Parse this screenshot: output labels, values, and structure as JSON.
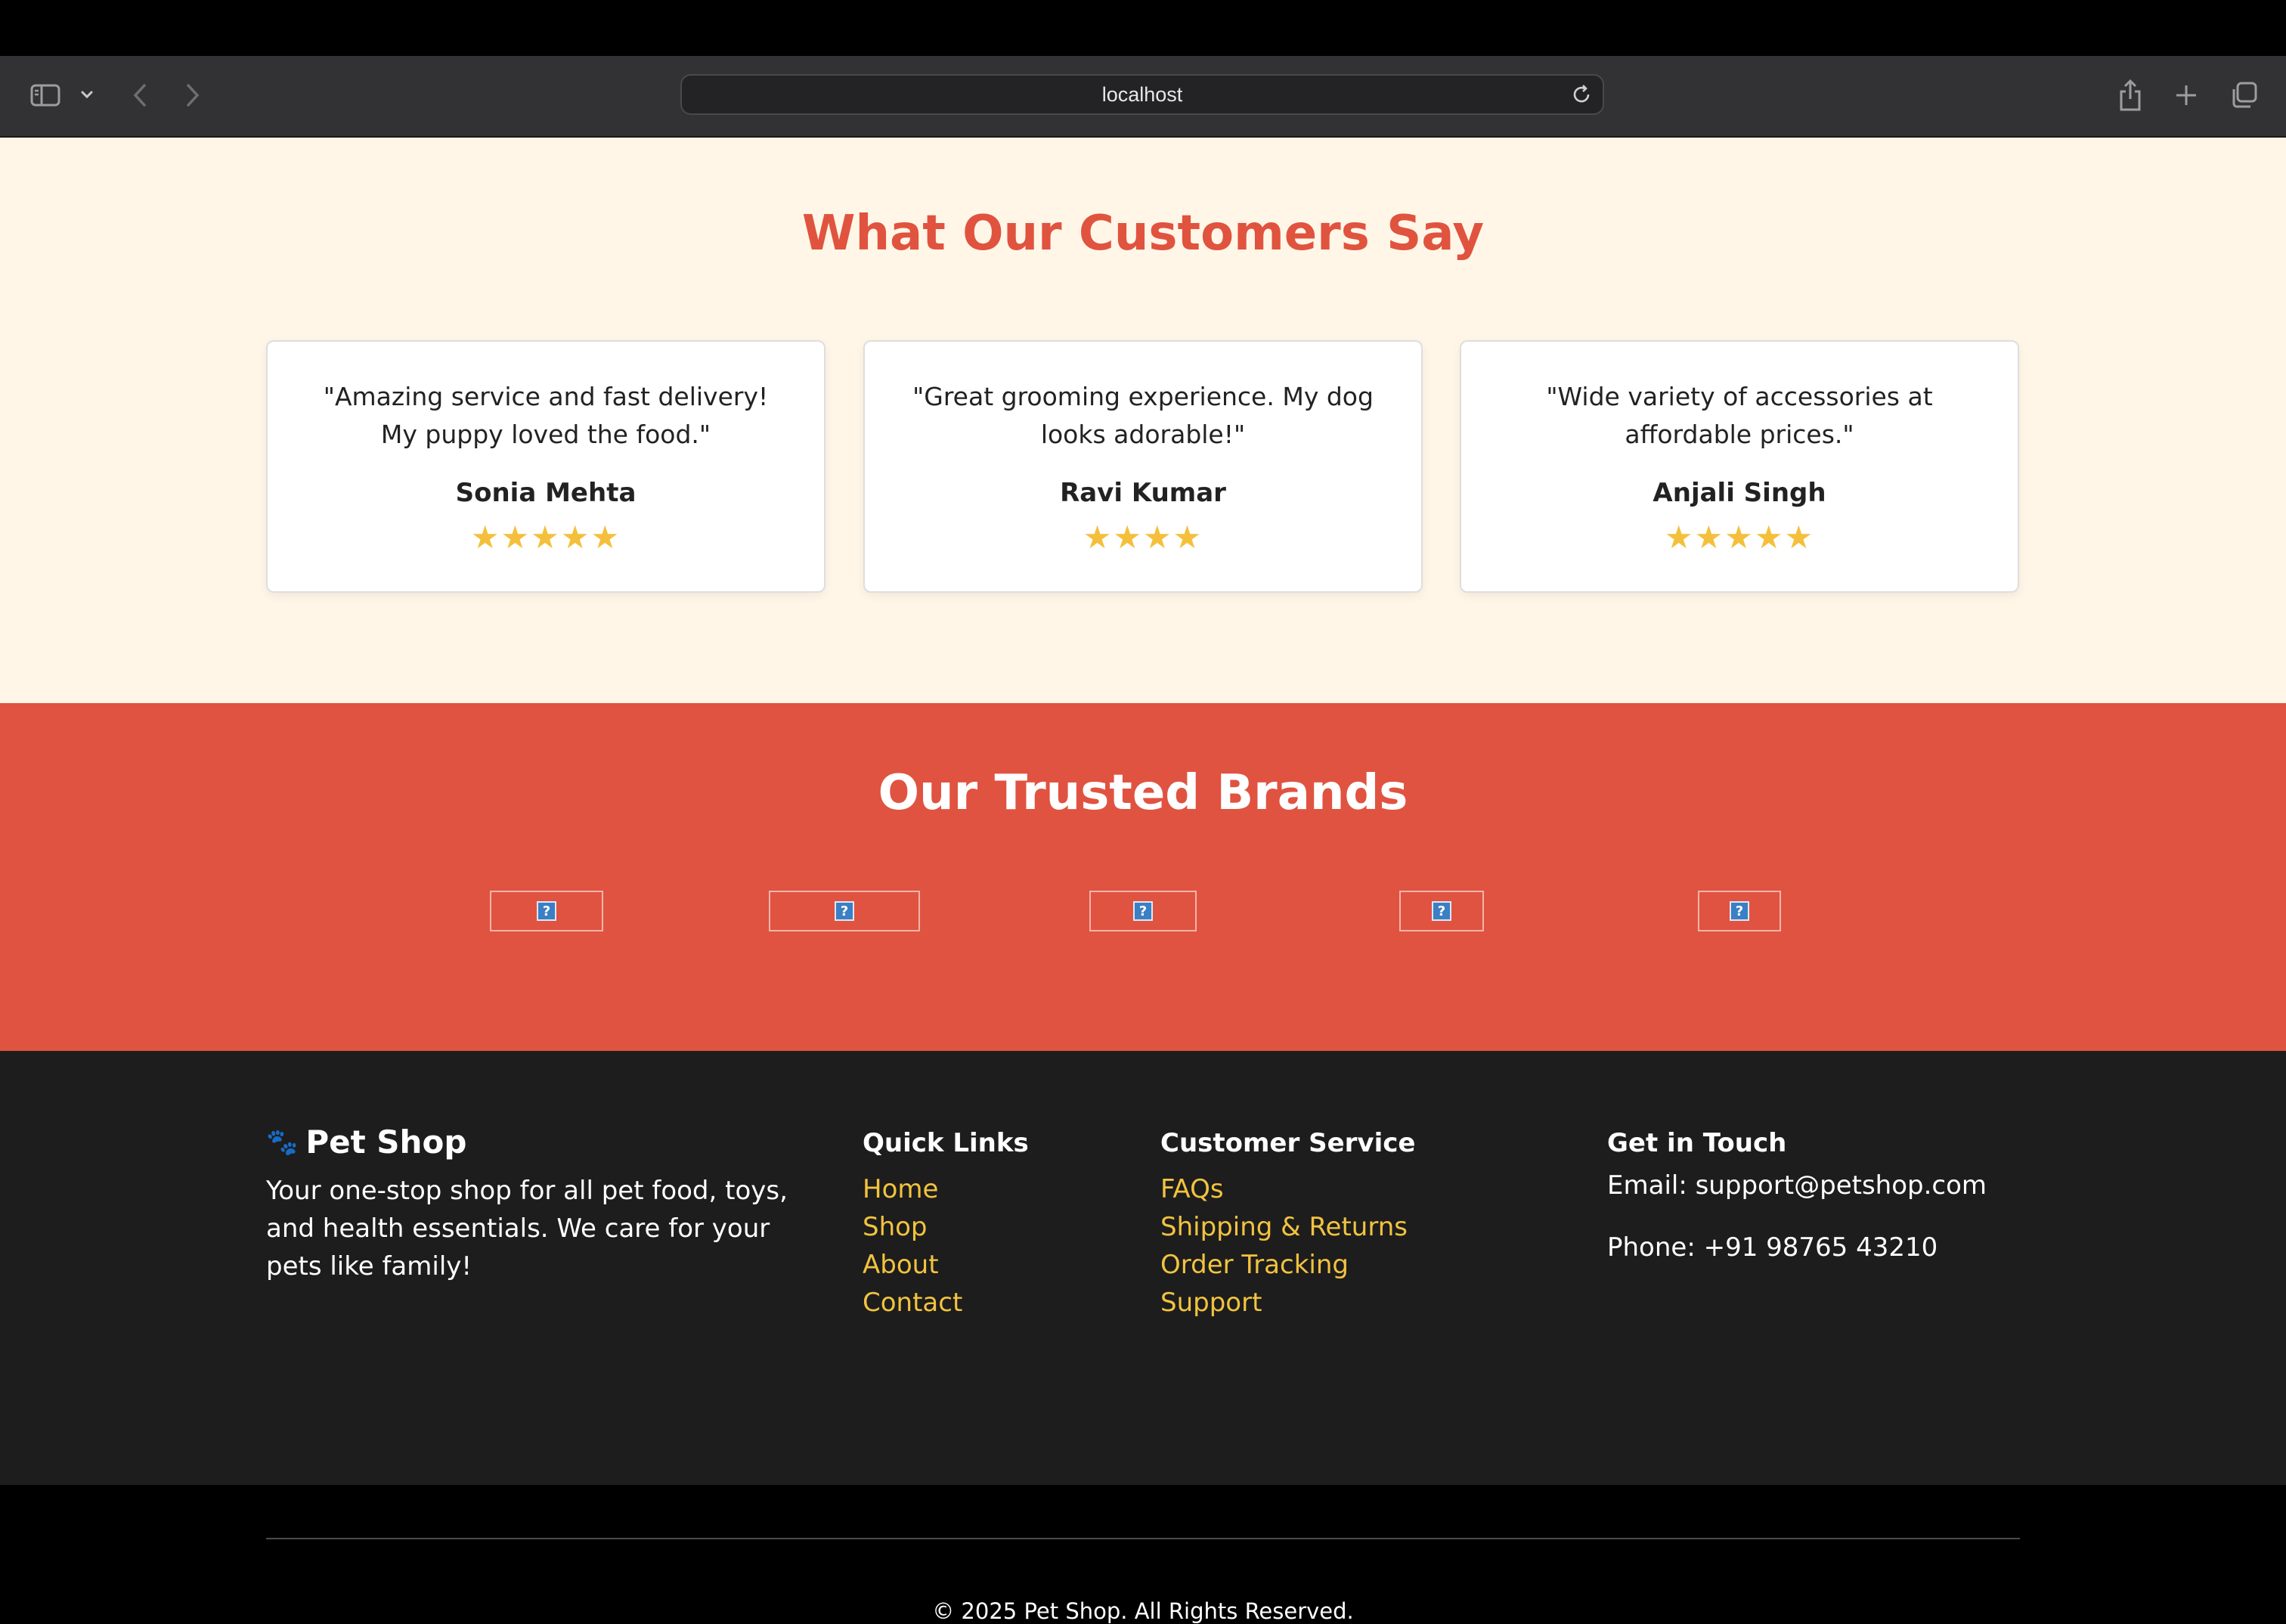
{
  "browser": {
    "url": "localhost",
    "icons": [
      "sidebar-icon",
      "chevron-down-icon",
      "back-icon",
      "forward-icon",
      "reload-icon",
      "share-icon",
      "plus-icon",
      "tabs-icon"
    ]
  },
  "testimonials": {
    "title": "What Our Customers Say",
    "items": [
      {
        "quote": "\"Amazing service and fast delivery! My puppy loved the food.\"",
        "name": "Sonia Mehta",
        "stars": "★★★★★",
        "rating": 5
      },
      {
        "quote": "\"Great grooming experience. My dog looks adorable!\"",
        "name": "Ravi Kumar",
        "stars": "★★★★",
        "rating": 4
      },
      {
        "quote": "\"Wide variety of accessories at affordable prices.\"",
        "name": "Anjali Singh",
        "stars": "★★★★★",
        "rating": 5
      }
    ],
    "star_color": "#f4c03c"
  },
  "brands": {
    "title": "Our Trusted Brands",
    "logos": [
      "broken-image-icon",
      "broken-image-icon",
      "broken-image-icon",
      "broken-image-icon",
      "broken-image-icon"
    ],
    "background": "#e05341"
  },
  "footer": {
    "brand": "Pet Shop",
    "brand_icon": "paw-icon",
    "description": "Your one-stop shop for all pet food, toys, and health essentials. We care for your pets like family!",
    "quick_links": {
      "title": "Quick Links",
      "items": [
        "Home",
        "Shop",
        "About",
        "Contact"
      ]
    },
    "customer_service": {
      "title": "Customer Service",
      "items": [
        "FAQs",
        "Shipping & Returns",
        "Order Tracking",
        "Support"
      ]
    },
    "contact": {
      "title": "Get in Touch",
      "email": "Email: support@petshop.com",
      "phone": "Phone: +91 98765 43210"
    },
    "copyright": "© 2025 Pet Shop. All Rights Reserved.",
    "link_color": "#f2c33f"
  }
}
